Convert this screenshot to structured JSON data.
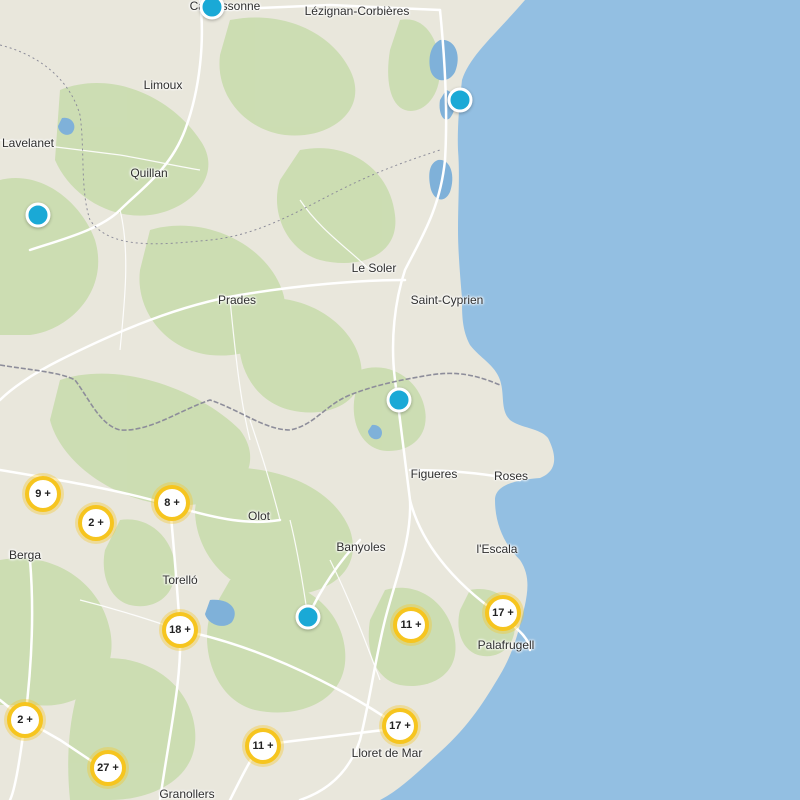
{
  "colors": {
    "sea": "#93bfe2",
    "land": "#e9e7dc",
    "forest": "#c9dcae",
    "road": "#ffffff",
    "border": "#8d8d9a",
    "lake": "#7fb1d9",
    "cluster_ring": "#f6c51f",
    "marker": "#1aa9d6"
  },
  "places": [
    {
      "id": "carcassonne",
      "name": "Carcassonne"
    },
    {
      "id": "lezignan",
      "name": "Lézignan-Corbières"
    },
    {
      "id": "limoux",
      "name": "Limoux"
    },
    {
      "id": "lavelanet",
      "name": "Lavelanet"
    },
    {
      "id": "quillan",
      "name": "Quillan"
    },
    {
      "id": "le-soler",
      "name": "Le Soler"
    },
    {
      "id": "prades",
      "name": "Prades"
    },
    {
      "id": "saint-cyprien",
      "name": "Saint-Cyprien"
    },
    {
      "id": "figueres",
      "name": "Figueres"
    },
    {
      "id": "roses",
      "name": "Roses"
    },
    {
      "id": "olot",
      "name": "Olot"
    },
    {
      "id": "banyoles",
      "name": "Banyoles"
    },
    {
      "id": "lescala",
      "name": "l'Escala"
    },
    {
      "id": "berga",
      "name": "Berga"
    },
    {
      "id": "torello",
      "name": "Torelló"
    },
    {
      "id": "palafrugell",
      "name": "Palafrugell"
    },
    {
      "id": "lloret",
      "name": "Lloret de Mar"
    },
    {
      "id": "granollers",
      "name": "Granollers"
    }
  ],
  "clusters": [
    {
      "id": "c1",
      "label": "9 +"
    },
    {
      "id": "c2",
      "label": "2 +"
    },
    {
      "id": "c3",
      "label": "8 +"
    },
    {
      "id": "c4",
      "label": "18 +"
    },
    {
      "id": "c5",
      "label": "11 +"
    },
    {
      "id": "c6",
      "label": "17 +"
    },
    {
      "id": "c7",
      "label": "2 +"
    },
    {
      "id": "c8",
      "label": "17 +"
    },
    {
      "id": "c9",
      "label": "11 +"
    },
    {
      "id": "c10",
      "label": "27 +"
    }
  ],
  "markers": [
    {
      "id": "m1"
    },
    {
      "id": "m2"
    },
    {
      "id": "m3"
    },
    {
      "id": "m4"
    },
    {
      "id": "m5"
    }
  ]
}
